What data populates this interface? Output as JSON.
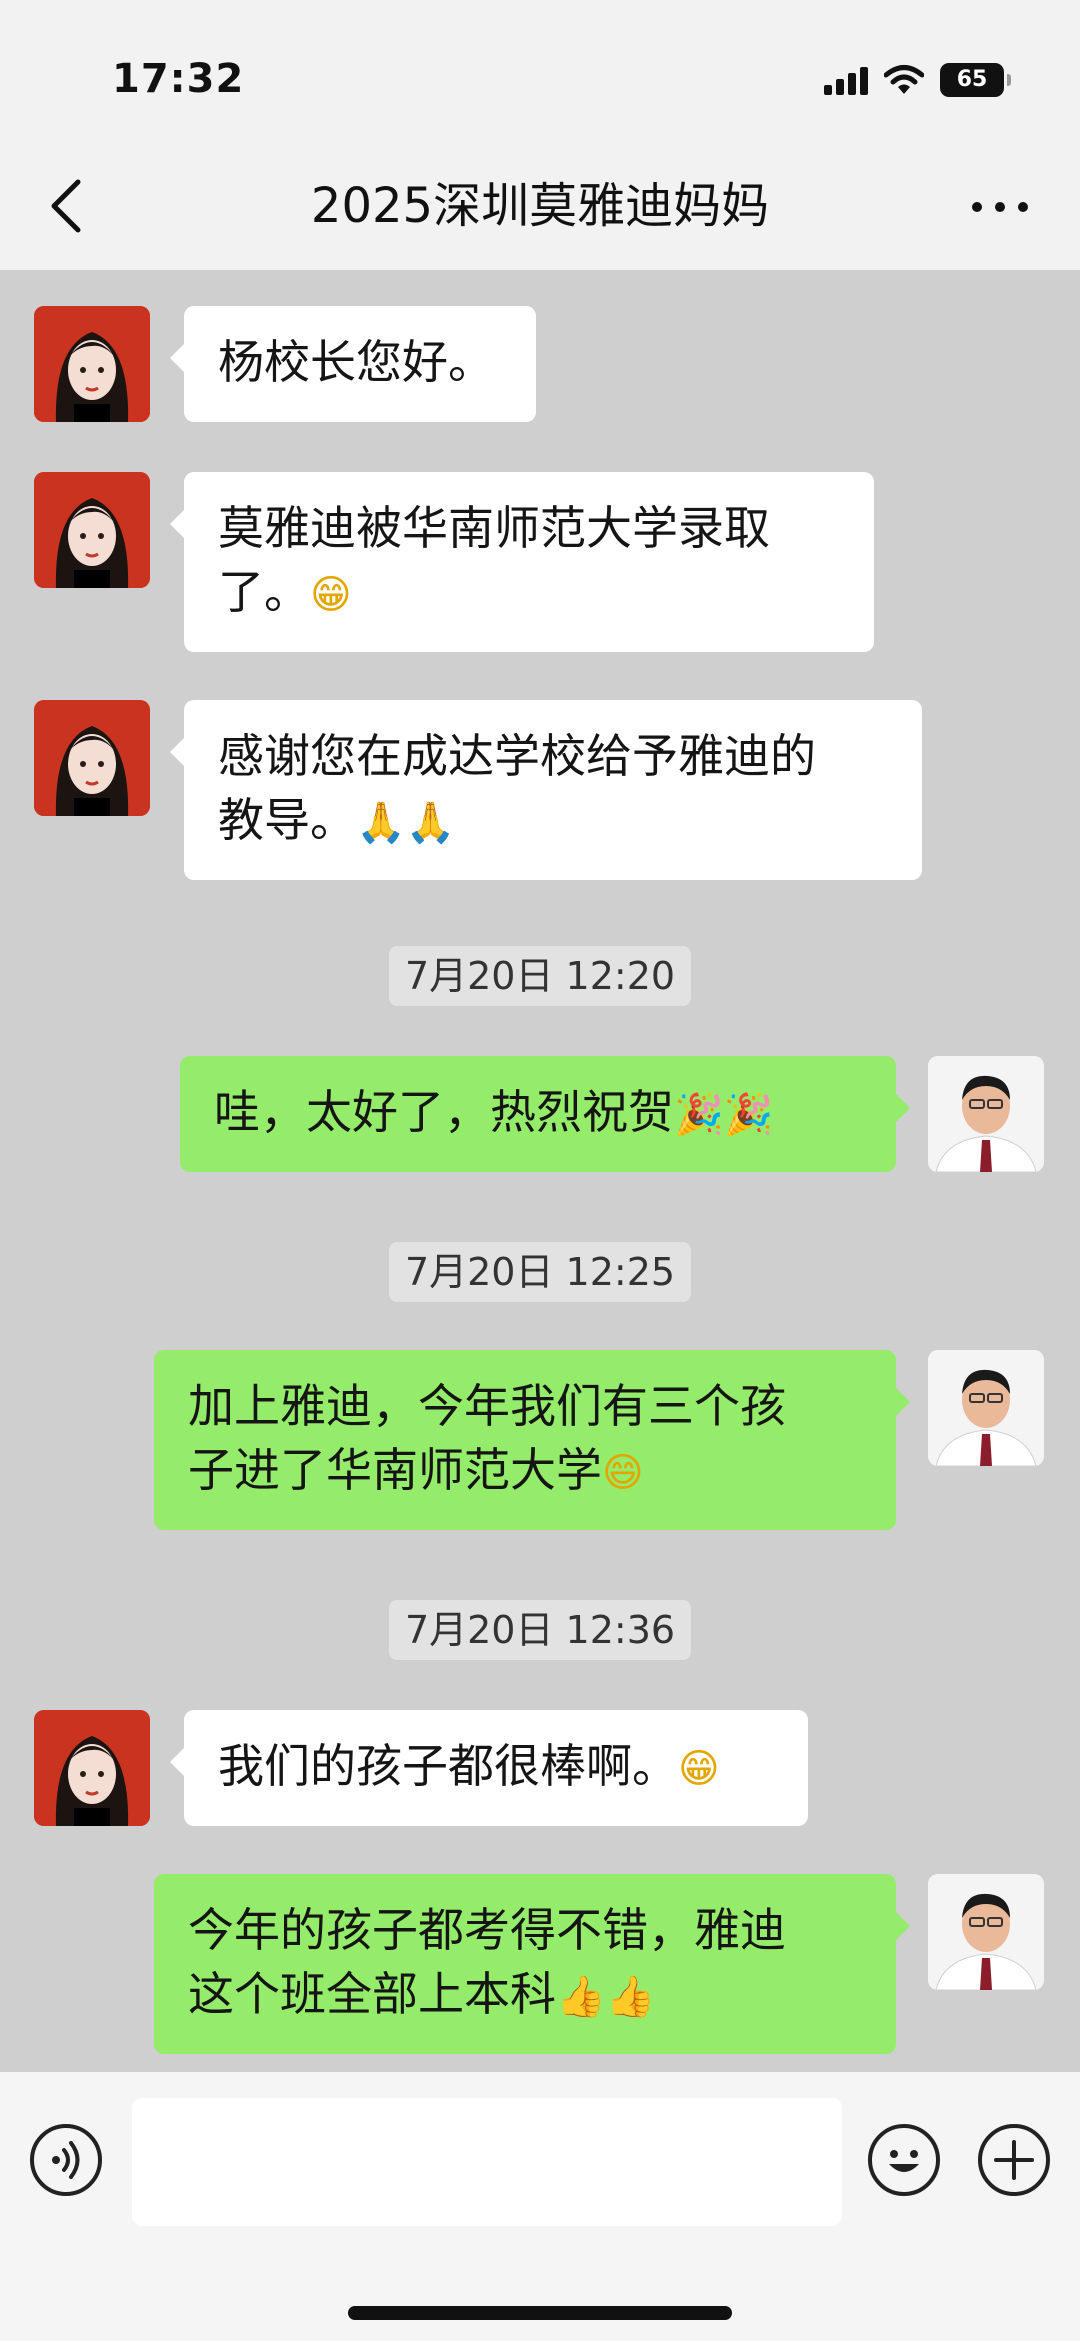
{
  "status_bar": {
    "time": "17:32",
    "battery": "65"
  },
  "nav": {
    "title": "2025深圳莫雅迪妈妈"
  },
  "messages": [
    {
      "side": "left",
      "text": "杨校长您好。"
    },
    {
      "side": "left",
      "line1": "莫雅迪被华南师范大学录取",
      "line2": "了。",
      "emoji": "😁"
    },
    {
      "side": "left",
      "line1": "感谢您在成达学校给予雅迪的",
      "line2": "教导。",
      "emoji": "🙏🙏"
    },
    {
      "type": "timestamp",
      "text": "7月20日 12:20"
    },
    {
      "side": "right",
      "text": "哇，太好了，热烈祝贺",
      "emoji": "🎉🎉"
    },
    {
      "type": "timestamp",
      "text": "7月20日 12:25"
    },
    {
      "side": "right",
      "line1": "加上雅迪，今年我们有三个孩",
      "line2": "子进了华南师范大学",
      "emoji": "😄"
    },
    {
      "type": "timestamp",
      "text": "7月20日 12:36"
    },
    {
      "side": "left",
      "text": "我们的孩子都很棒啊。",
      "emoji": "😁"
    },
    {
      "side": "right",
      "line1": "今年的孩子都考得不错，雅迪",
      "line2": "这个班全部上本科",
      "emoji": "👍👍"
    }
  ],
  "input": {
    "placeholder": ""
  },
  "colors": {
    "my_bubble": "#94ec6a",
    "their_bubble": "#ffffff",
    "chat_bg": "#cfcfcf"
  },
  "icons": {
    "voice": "voice-icon",
    "emoji": "emoji-icon",
    "plus": "plus-icon",
    "back": "back-chevron-icon",
    "more": "more-icon"
  }
}
